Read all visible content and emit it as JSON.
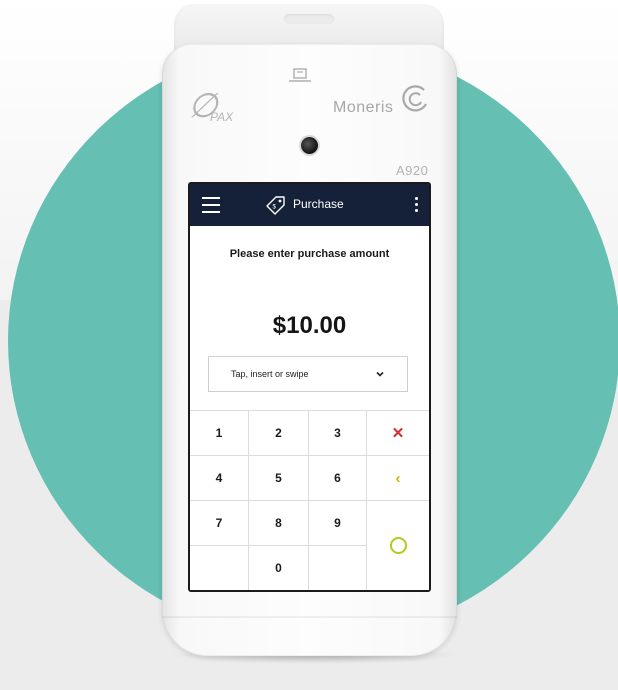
{
  "device": {
    "brand_left": "∅",
    "brand_left_sub": "PAX",
    "brand_right": "Moneris",
    "model": "A920"
  },
  "app_bar": {
    "title": "Purchase",
    "menu_icon": "hamburger-menu-icon",
    "title_icon": "price-tag-icon",
    "overflow_icon": "vertical-ellipsis-icon"
  },
  "screen": {
    "prompt": "Please enter purchase amount",
    "amount": "$10.00",
    "payment_method": {
      "selected": "Tap, insert or swipe",
      "icon": "chevron-down-icon"
    }
  },
  "keypad": {
    "keys": [
      "1",
      "2",
      "3",
      "✕",
      "4",
      "5",
      "6",
      "‹",
      "7",
      "8",
      "9",
      "",
      "0",
      ""
    ],
    "colors": {
      "cancel": "#d12d2d",
      "backspace": "#c8b400",
      "enter": "#b7c81f"
    }
  },
  "colors": {
    "app_bar": "#152138",
    "background_circle": "#65bfb3"
  }
}
